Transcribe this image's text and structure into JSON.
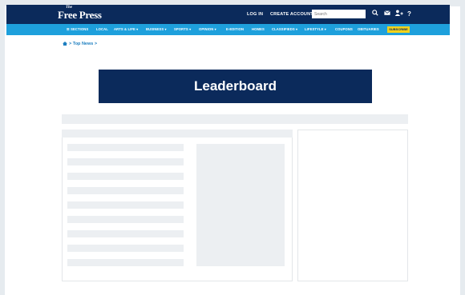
{
  "header": {
    "logo_prefix": "The",
    "logo_name": "Free Press",
    "login_label": "LOG IN",
    "create_account_label": "CREATE ACCOUNT",
    "search_placeholder": "Search",
    "icons": [
      "search-icon",
      "mail-icon",
      "user-icon",
      "help-icon"
    ]
  },
  "nav": {
    "items": [
      "☰ SECTIONS",
      "LOCAL",
      "ARTS & LIFE ▾",
      "BUSINESS ▾",
      "SPORTS ▾",
      "OPINION ▾",
      "E-EDITION",
      "HOMES",
      "CLASSIFIEDS ▾",
      "LIFESTYLE ▾",
      "COUPONS",
      "OBITUARIES"
    ],
    "subscribe_label": "SUBSCRIBE"
  },
  "breadcrumb": {
    "text": "> Top News >"
  },
  "ad": {
    "label": "Leaderboard"
  },
  "colors": {
    "header_bg": "#0b2a5b",
    "nav_bg": "#1ea0dc",
    "subscribe_bg": "#f2d21a",
    "placeholder": "#eceff2"
  }
}
